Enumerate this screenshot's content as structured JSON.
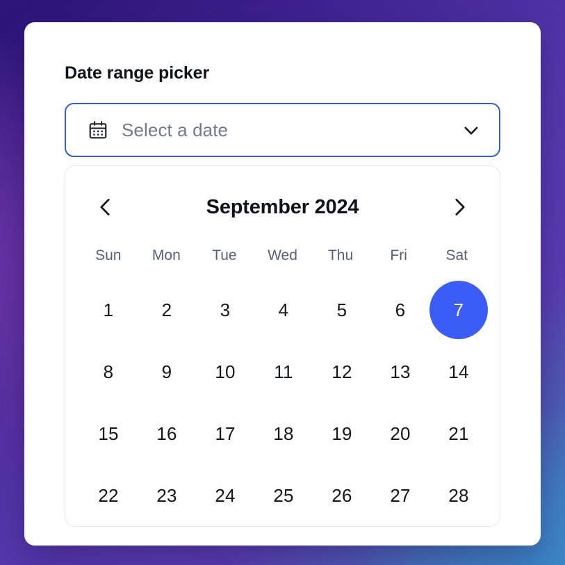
{
  "background": {
    "gradient_colors": [
      "#2b1576",
      "#5437ab",
      "#7037ab",
      "#3d87c7"
    ]
  },
  "card": {
    "background_color": "#ffffff"
  },
  "page_title": "Date range picker",
  "date_field": {
    "placeholder": "Select a date",
    "value": "",
    "border_color": "#2f5fdb",
    "icons": {
      "leading": "calendar-icon",
      "trailing": "chevron-down-icon"
    }
  },
  "calendar": {
    "month_label": "September 2024",
    "prev_icon": "chevron-left-icon",
    "next_icon": "chevron-right-icon",
    "weekdays": [
      "Sun",
      "Mon",
      "Tue",
      "Wed",
      "Thu",
      "Fri",
      "Sat"
    ],
    "selected_day": 7,
    "selected_color": "#3b5cf6",
    "leading_blanks": 0,
    "days": [
      1,
      2,
      3,
      4,
      5,
      6,
      7,
      8,
      9,
      10,
      11,
      12,
      13,
      14,
      15,
      16,
      17,
      18,
      19,
      20,
      21,
      22,
      23,
      24,
      25,
      26,
      27,
      28
    ]
  }
}
